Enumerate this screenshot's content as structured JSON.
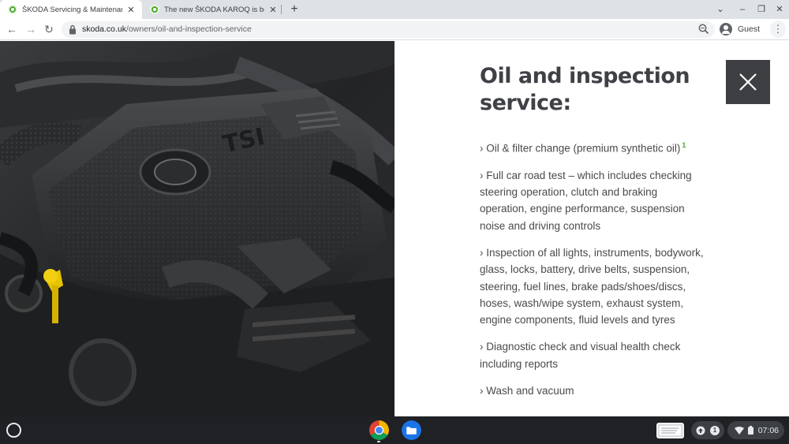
{
  "browser": {
    "tabs": [
      {
        "title": "ŠKODA Servicing & Maintenance",
        "close": "✕",
        "active": true
      },
      {
        "title": "The new ŠKODA KAROQ is being",
        "close": "✕",
        "active": false
      }
    ],
    "new_tab": "+",
    "window_controls": {
      "dropdown": "⌄",
      "minimize": "–",
      "restore": "❐",
      "close": "✕"
    },
    "nav": {
      "back": "←",
      "forward": "→",
      "reload": "↻"
    },
    "url_host": "skoda.co.uk",
    "url_path": "/owners/oil-and-inspection-service",
    "profile_label": "Guest",
    "menu": "⋮"
  },
  "page": {
    "heading": "Oil and inspection service:",
    "close_glyph": "✕",
    "bullets": [
      {
        "text": "› Oil & filter change (premium synthetic oil)",
        "ref": "1"
      },
      {
        "text": "› Full car road test – which includes checking steering operation, clutch and braking operation, engine performance, suspension noise and driving controls"
      },
      {
        "text": "› Inspection of all lights, instruments, bodywork, glass, locks, battery, drive belts, suspension, steering, fuel lines, brake pads/shoes/discs, hoses, wash/wipe system, exhaust system, engine components, fluid levels and tyres"
      },
      {
        "text": "› Diagnostic check and visual health check including reports"
      },
      {
        "text": "› Wash and vacuum"
      }
    ],
    "image_alt": "ŠKODA TSI engine bay with yellow oil dipstick"
  },
  "shelf": {
    "apps": [
      "chrome-icon",
      "files-icon"
    ],
    "notification_count": "1",
    "time": "07:06"
  },
  "colors": {
    "accent": "#4ba82e",
    "heading": "#3f4146",
    "shelf": "#202124"
  }
}
